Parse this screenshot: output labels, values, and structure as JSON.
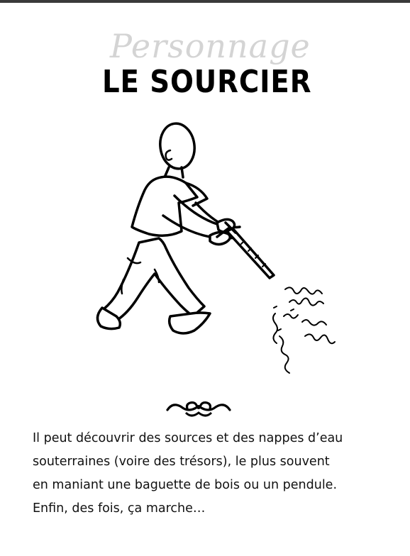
{
  "header": {
    "kicker": "Personnage",
    "title": "LE SOURCIER"
  },
  "illustration": {
    "icon": "dowser-figure-icon"
  },
  "divider": {
    "icon": "ornament-divider-icon"
  },
  "description": {
    "lines": [
      "Il peut découvrir des sources et des nappes d’eau",
      "souterraines (voire des trésors), le plus souvent",
      "en maniant une baguette de bois ou un pendule.",
      "Enfin, des fois, ça marche…"
    ]
  }
}
